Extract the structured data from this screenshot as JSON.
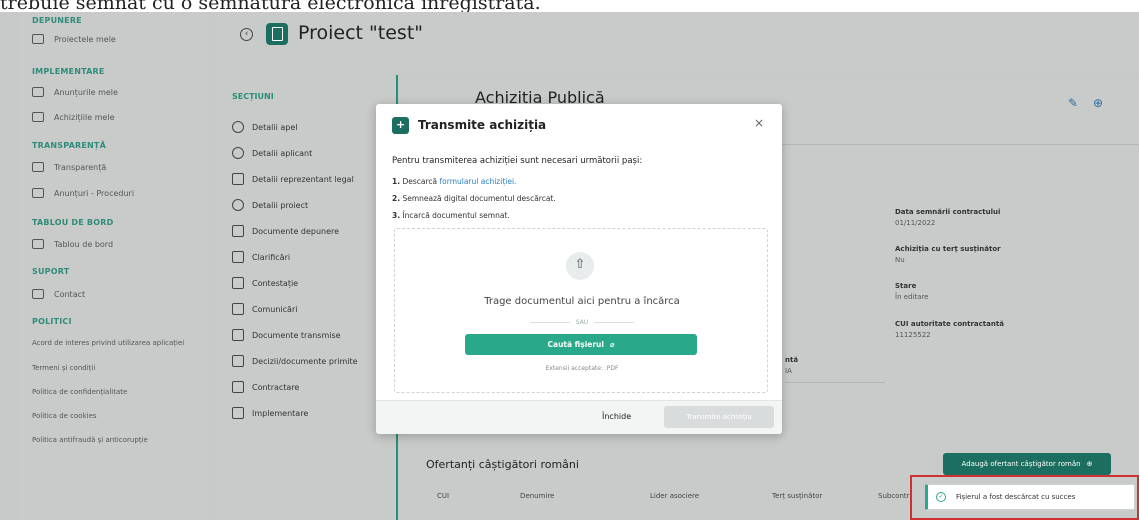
{
  "doc_strip": {
    "text": "trebuie semnat cu o semnatura electronica inregistrata."
  },
  "header": {
    "title": "Proiect \"test\""
  },
  "nav": {
    "depunere": "DEPUNERE",
    "proiectele": "Proiectele mele",
    "implementare": "IMPLEMENTARE",
    "anunturile": "Anunțurile mele",
    "achizitiile": "Achizițiile mele",
    "transparenta_sec": "TRANSPARENȚĂ",
    "transparenta": "Transparență",
    "anunturi_proceduri": "Anunțuri - Proceduri",
    "tablou_sec": "TABLOU DE BORD",
    "tablou": "Tablou de bord",
    "suport_sec": "SUPORT",
    "contact": "Contact",
    "politici_sec": "POLITICI",
    "acord": "Acord de interes privind utilizarea aplicației",
    "termeni": "Termeni și condiții",
    "confidentialitate": "Politica de confidențialitate",
    "cookies": "Politica de cookies",
    "antifrauda": "Politica antifraudă și anticorupție"
  },
  "sections": {
    "head": "SECȚIUNI",
    "items": [
      "Detalii apel",
      "Detalii aplicant",
      "Detalii reprezentant legal",
      "Detalii proiect",
      "Documente depunere",
      "Clarificări",
      "Contestație",
      "Comunicări",
      "Documente transmise",
      "Decizii/documente primite",
      "Contractare",
      "Implementare"
    ]
  },
  "main": {
    "title": "Achiziția Publică",
    "data_semnarii_k": "Data semnării contractului",
    "data_semnarii_v": "01/11/2022",
    "achizitia_tert_k": "Achiziția cu terț susținător",
    "achizitia_tert_v": "Nu",
    "stare_k": "Stare",
    "stare_v": "În editare",
    "cui_k": "CUI autoritate contractantă",
    "cui_v": "11125522",
    "partial_a": "ntă",
    "partial_b": "IA",
    "ofertanti": "Ofertanți câștigători români",
    "add_btn": "Adaugă ofertant câștigător român",
    "cols": [
      "CUI",
      "Denumire",
      "Lider asociere",
      "Terț susținător",
      "Subcontr"
    ]
  },
  "modal": {
    "title": "Transmite achiziția",
    "close": "×",
    "intro": "Pentru transmiterea achiziției sunt necesari următorii pași:",
    "step1_num": "1.",
    "step1_pre": "Descarcă",
    "step1_link": "formularul achiziției.",
    "step2_num": "2.",
    "step2": "Semnează digital documentul descărcat.",
    "step3_num": "3.",
    "step3": "Încarcă documentul semnat.",
    "drop_text": "Trage documentul aici pentru a încărca",
    "sau": "SAU",
    "browse": "Caută fișierul",
    "ext": "Extensii acceptate: .PDF",
    "inchide": "Închide",
    "transmite": "Transmite achiziția"
  },
  "toast": {
    "text": "Fișierul a fost descărcat cu succes"
  },
  "colors": {
    "accent": "#1c6f60",
    "button": "#2aa98a",
    "highlight": "#d0302f"
  }
}
